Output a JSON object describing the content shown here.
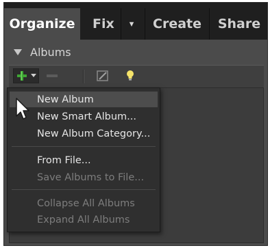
{
  "tabs": [
    {
      "label": "Organize",
      "active": true
    },
    {
      "label": "Fix",
      "active": false,
      "has_dropdown": true
    },
    {
      "label": "Create",
      "active": false
    },
    {
      "label": "Share",
      "active": false
    }
  ],
  "albums_header": {
    "label": "Albums",
    "expanded": true
  },
  "toolbar": {
    "icons": [
      "add-icon",
      "dropdown-arrow-icon",
      "remove-icon",
      "edit-icon",
      "lightbulb-icon"
    ],
    "accent_green": "#3fa535"
  },
  "menu": {
    "items": [
      {
        "label": "New Album",
        "enabled": true,
        "highlighted": true
      },
      {
        "label": "New Smart Album...",
        "enabled": true
      },
      {
        "label": "New Album Category...",
        "enabled": true
      },
      {
        "label": "From File...",
        "enabled": true
      },
      {
        "label": "Save Albums to File...",
        "enabled": false
      },
      {
        "label": "Collapse All Albums",
        "enabled": false
      },
      {
        "label": "Expand All Albums",
        "enabled": false
      }
    ]
  }
}
